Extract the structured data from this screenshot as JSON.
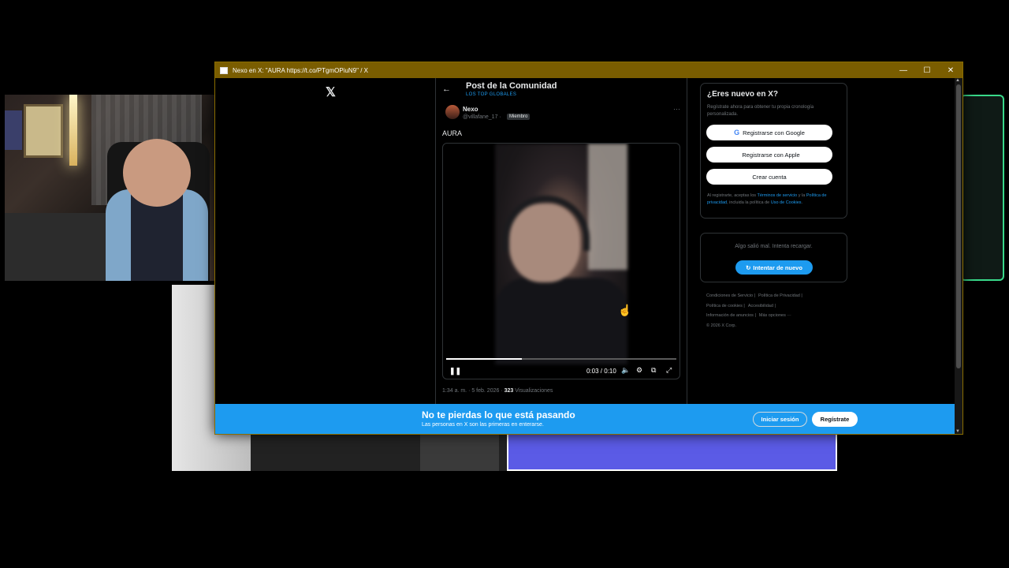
{
  "window": {
    "title": "Nexo en X: \"AURA https://t.co/PTgmOPiuN9\" / X",
    "minimize_glyph": "—",
    "maximize_glyph": "☐",
    "close_glyph": "✕"
  },
  "nav": {
    "logo": "𝕏"
  },
  "header": {
    "back_glyph": "←",
    "title": "Post de la Comunidad",
    "community": "LOS TOP GLOBALES"
  },
  "post": {
    "author_name": "Nexo",
    "author_handle": "@villafane_17 ·",
    "badge": "Miembro",
    "more_glyph": "···",
    "text": "AURA",
    "timestamp": "1:34 a. m. · 5 feb. 2026 ·",
    "views_count": "323",
    "views_label": "Visualizaciones"
  },
  "video": {
    "time": "0:03 / 0:10",
    "progress": 0.33,
    "pause_glyph": "❚❚",
    "volume_glyph": "🔈",
    "settings_glyph": "⚙",
    "pip_glyph": "⧉",
    "fullscreen_glyph": "⤢",
    "cursor_glyph": "☝"
  },
  "signup": {
    "title": "¿Eres nuevo en X?",
    "desc": "Regístrate ahora para obtener tu propia cronología personalizada.",
    "google_glyph": "G",
    "google_label": "Registrarse con Google",
    "apple_glyph": "",
    "apple_label": "Registrarse con Apple",
    "create_label": "Crear cuenta",
    "legal_1": "Al registrarte, aceptas los ",
    "legal_terms": "Términos de servicio",
    "legal_2": " y la ",
    "legal_privacy": "Política de privacidad",
    "legal_3": ", incluida la política de ",
    "legal_cookies": "Uso de Cookies",
    "legal_4": "."
  },
  "error": {
    "text": "Algo salió mal. Intenta recargar.",
    "retry_glyph": "↻",
    "retry_label": "Intentar de nuevo"
  },
  "footer": {
    "terms": "Condiciones de Servicio |",
    "privacy": "Política de Privacidad |",
    "cookies": "Política de cookies |",
    "accessibility": "Accesibilidad |",
    "ads": "Información de anuncios |",
    "more": "Más opciones ···",
    "copyright": "© 2026 X Corp."
  },
  "banner": {
    "title": "No te pierdas lo que está pasando",
    "subtitle": "Las personas en X son las primeras en enterarse.",
    "login_label": "Iniciar sesión",
    "register_label": "Regístrate"
  },
  "scrollbar": {
    "up_glyph": "▲",
    "down_glyph": "▼"
  },
  "colors": {
    "accent": "#1d9bf0",
    "titlebar": "#7a5d00",
    "background": "#000000"
  }
}
